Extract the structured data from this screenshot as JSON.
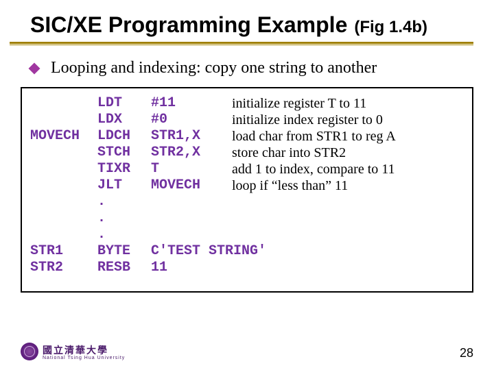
{
  "title": "SIC/XE Programming Example",
  "title_fig": "(Fig 1.4b)",
  "bullet": "Looping and indexing: copy one string to another",
  "code": {
    "rows": [
      {
        "label": "",
        "mnem": "LDT",
        "oper": "#11",
        "cmt": "initialize register T to 11"
      },
      {
        "label": "",
        "mnem": "LDX",
        "oper": "#0",
        "cmt": "initialize index register to 0"
      },
      {
        "label": "MOVECH",
        "mnem": "LDCH",
        "oper": "STR1,X",
        "cmt": "load char from STR1 to reg A"
      },
      {
        "label": "",
        "mnem": "STCH",
        "oper": "STR2,X",
        "cmt": "store char into STR2"
      },
      {
        "label": "",
        "mnem": "TIXR",
        "oper": "T",
        "cmt": "add 1 to index, compare to 11"
      },
      {
        "label": "",
        "mnem": "JLT",
        "oper": "MOVECH",
        "cmt": "loop if “less than” 11"
      },
      {
        "label": "",
        "mnem": ".",
        "oper": "",
        "cmt": ""
      },
      {
        "label": "",
        "mnem": ".",
        "oper": "",
        "cmt": ""
      },
      {
        "label": "",
        "mnem": ".",
        "oper": "",
        "cmt": ""
      },
      {
        "label": "STR1",
        "mnem": "BYTE",
        "oper": "C'TEST STRING'",
        "cmt": ""
      },
      {
        "label": "STR2",
        "mnem": "RESB",
        "oper": "11",
        "cmt": ""
      }
    ]
  },
  "footer": {
    "uni_cn": "國立清華大學",
    "uni_en": "National Tsing Hua University",
    "page": "28"
  }
}
